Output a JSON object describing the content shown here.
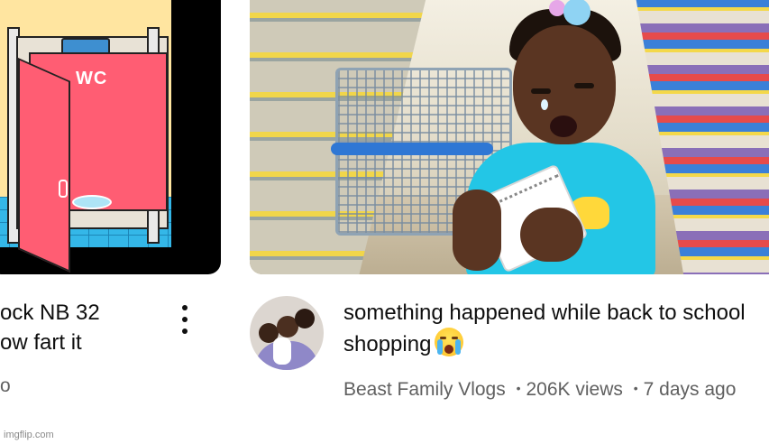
{
  "left_video": {
    "title_line1": "ock NB 32",
    "title_line2": "ow fart it",
    "meta": "o",
    "thumbnail_sign": "WC",
    "menu_icon": "kebab-menu-icon"
  },
  "right_video": {
    "title": "something happened while back to school shopping",
    "title_emoji": "loudly-crying-face-emoji",
    "channel": "Beast Family Vlogs",
    "views": "206K views",
    "age": "7 days ago",
    "separator": "•"
  },
  "watermark": "imgflip.com",
  "colors": {
    "text_primary": "#0f0f0f",
    "text_secondary": "#606060",
    "door_pink": "#ff5d73",
    "shirt_cyan": "#23c6e6"
  }
}
